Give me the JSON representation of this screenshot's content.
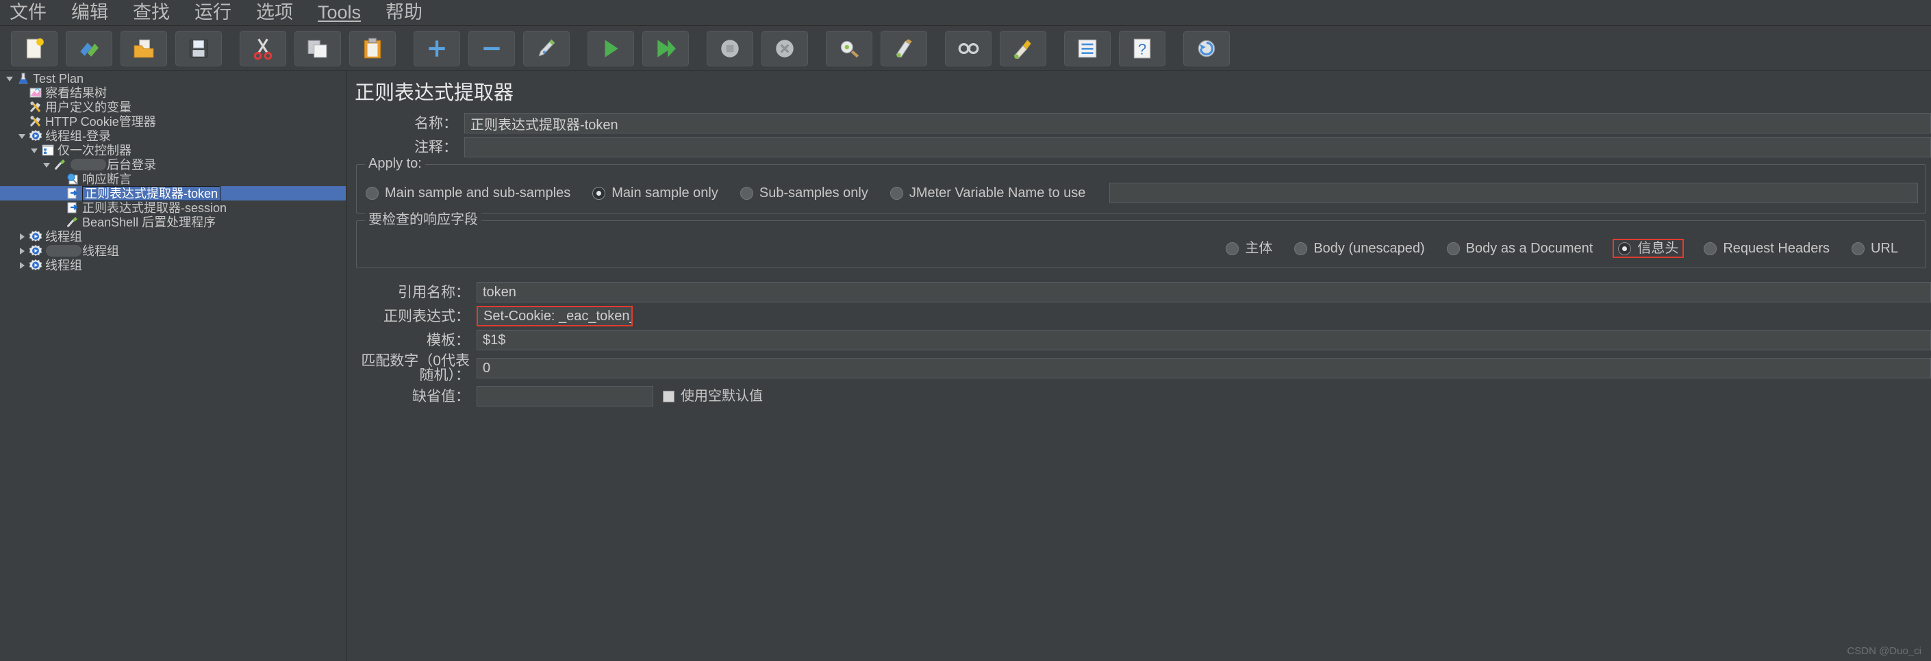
{
  "menubar": {
    "items": [
      {
        "label": "文件",
        "underlined": false
      },
      {
        "label": "编辑",
        "underlined": false
      },
      {
        "label": "查找",
        "underlined": false
      },
      {
        "label": "运行",
        "underlined": false
      },
      {
        "label": "选项",
        "underlined": false
      },
      {
        "label": "Tools",
        "underlined": true
      },
      {
        "label": "帮助",
        "underlined": false
      }
    ]
  },
  "toolbar": {
    "buttons": [
      {
        "name": "new-icon"
      },
      {
        "name": "templates-icon"
      },
      {
        "name": "open-icon"
      },
      {
        "name": "save-icon"
      },
      {
        "name": "cut-icon"
      },
      {
        "name": "copy-icon"
      },
      {
        "name": "paste-icon"
      },
      {
        "name": "expand-all-icon"
      },
      {
        "name": "collapse-all-icon"
      },
      {
        "name": "toggle-icon"
      },
      {
        "name": "start-icon"
      },
      {
        "name": "start-no-pauses-icon"
      },
      {
        "name": "stop-icon"
      },
      {
        "name": "shutdown-icon"
      },
      {
        "name": "clear-icon"
      },
      {
        "name": "clear-all-icon"
      },
      {
        "name": "search-icon"
      },
      {
        "name": "reset-search-icon"
      },
      {
        "name": "function-helper-icon"
      },
      {
        "name": "help-icon"
      },
      {
        "name": "undo-icon"
      }
    ]
  },
  "tree": {
    "nodes": [
      {
        "label": "Test Plan",
        "depth": 0,
        "toggle": "open",
        "icon": "test-plan-icon",
        "selected": false,
        "redacted": false
      },
      {
        "label": "察看结果树",
        "depth": 1,
        "toggle": "none",
        "icon": "view-results-tree-icon",
        "selected": false,
        "redacted": false
      },
      {
        "label": "用户定义的变量",
        "depth": 1,
        "toggle": "none",
        "icon": "user-defined-variables-icon",
        "selected": false,
        "redacted": false
      },
      {
        "label": "HTTP Cookie管理器",
        "depth": 1,
        "toggle": "none",
        "icon": "http-cookie-manager-icon",
        "selected": false,
        "redacted": false
      },
      {
        "label": "线程组-登录",
        "depth": 1,
        "toggle": "open",
        "icon": "thread-group-icon",
        "selected": false,
        "redacted": false
      },
      {
        "label": "仅一次控制器",
        "depth": 2,
        "toggle": "open",
        "icon": "once-only-controller-icon",
        "selected": false,
        "redacted": false
      },
      {
        "label": "后台登录",
        "depth": 3,
        "toggle": "open",
        "icon": "http-request-icon",
        "selected": false,
        "redacted": true
      },
      {
        "label": "响应断言",
        "depth": 4,
        "toggle": "none",
        "icon": "response-assertion-icon",
        "selected": false,
        "redacted": false
      },
      {
        "label": "正则表达式提取器-token",
        "depth": 4,
        "toggle": "none",
        "icon": "regex-extractor-icon",
        "selected": true,
        "redacted": false
      },
      {
        "label": "正则表达式提取器-session",
        "depth": 4,
        "toggle": "none",
        "icon": "regex-extractor-icon",
        "selected": false,
        "redacted": false
      },
      {
        "label": "BeanShell 后置处理程序",
        "depth": 4,
        "toggle": "none",
        "icon": "beanshell-postprocessor-icon",
        "selected": false,
        "redacted": false
      },
      {
        "label": "线程组",
        "depth": 1,
        "toggle": "closed",
        "icon": "thread-group-icon",
        "selected": false,
        "redacted": false
      },
      {
        "label": "线程组",
        "depth": 1,
        "toggle": "closed",
        "icon": "thread-group-icon",
        "selected": false,
        "redacted": true
      },
      {
        "label": "线程组",
        "depth": 1,
        "toggle": "closed",
        "icon": "thread-group-icon",
        "selected": false,
        "redacted": false
      }
    ]
  },
  "panel": {
    "title": "正则表达式提取器",
    "name_label": "名称：",
    "name_value": "正则表达式提取器-token",
    "comment_label": "注释：",
    "comment_value": "",
    "apply_to": {
      "legend": "Apply to:",
      "options": [
        {
          "label": "Main sample and sub-samples",
          "selected": false
        },
        {
          "label": "Main sample only",
          "selected": true
        },
        {
          "label": "Sub-samples only",
          "selected": false
        },
        {
          "label": "JMeter Variable Name to use",
          "selected": false
        }
      ],
      "variable_value": ""
    },
    "response_field": {
      "legend": "要检查的响应字段",
      "options": [
        {
          "label": "主体",
          "selected": false,
          "highlighted": false
        },
        {
          "label": "Body (unescaped)",
          "selected": false,
          "highlighted": false
        },
        {
          "label": "Body as a Document",
          "selected": false,
          "highlighted": false
        },
        {
          "label": "信息头",
          "selected": true,
          "highlighted": true
        },
        {
          "label": "Request Headers",
          "selected": false,
          "highlighted": false
        },
        {
          "label": "URL",
          "selected": false,
          "highlighted": false
        }
      ]
    },
    "fields": [
      {
        "label": "引用名称：",
        "value": "token",
        "highlighted": false
      },
      {
        "label": "正则表达式：",
        "value": "Set-Cookie: _eac_token_=(.+?);",
        "highlighted": true
      },
      {
        "label": "模板：",
        "value": "$1$",
        "highlighted": false
      },
      {
        "label": "匹配数字（0代表随机）：",
        "value": "0",
        "highlighted": false
      }
    ],
    "default_label": "缺省值：",
    "default_value": "",
    "use_empty_default_label": "使用空默认值",
    "use_empty_default_checked": false
  },
  "watermark": "CSDN @Duo_ci",
  "colors": {
    "background": "#3c3f41",
    "selection": "#4a70b5",
    "highlight_border": "#e03b2f",
    "text": "#c7c7c7"
  }
}
